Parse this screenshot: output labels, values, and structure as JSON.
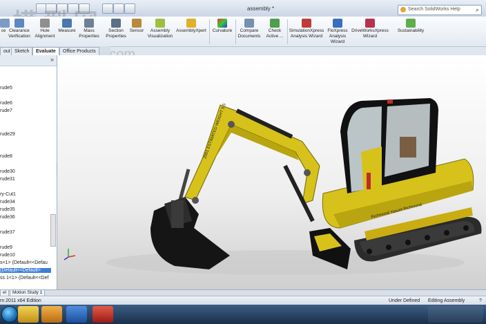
{
  "window": {
    "title": "assembly *"
  },
  "search": {
    "placeholder": "Search SolidWorks Help"
  },
  "watermark": {
    "line1": "模型网",
    "line2": "www.3dmox.com"
  },
  "ribbon": {
    "items": [
      "ce",
      "Clearance\nVerification",
      "Hole\nAlignment",
      "Measure",
      "Mass\nProperties",
      "Section\nProperties",
      "Sensor",
      "Assembly\nVisualization",
      "AssemblyXpert",
      "Curvature",
      "Compare\nDocuments",
      "Check\nActive ...",
      "SimulationXpress\nAnalysis Wizard",
      "FloXpress\nAnalysis\nWizard",
      "DriveWorksXpress\nWizard",
      "Sustainability"
    ]
  },
  "tabs": [
    "out",
    "Sketch",
    "Evaluate",
    "Office Products"
  ],
  "active_tab": "Evaluate",
  "tree": {
    "items": [
      "rude5",
      "rude6",
      "rude7",
      "rude29",
      "rude8",
      "rude30",
      "rude31",
      "ry-Cut1",
      "rude34",
      "rude35",
      "rude36",
      "rude37",
      "rude9",
      "rude10",
      "s<1> (Default<<Defau",
      "(Default<<Default>",
      "ss 1<1> (Default<<Def"
    ],
    "selected_index": 15
  },
  "bottom_tabs": [
    "el",
    "Motion Study 1"
  ],
  "status": {
    "left": "rn 2011 x64 Edition",
    "state": "Under Defined",
    "mode": "Editing Assembly",
    "help": "?"
  },
  "model_labels": {
    "arm": "2001 ESTIMATED WEIGHT 5.5",
    "body": "Richmond Yasunt Richmond"
  },
  "colors": {
    "accent": "#3d7fd6",
    "machine": "#d6c21a",
    "track": "#2b2b2b"
  }
}
